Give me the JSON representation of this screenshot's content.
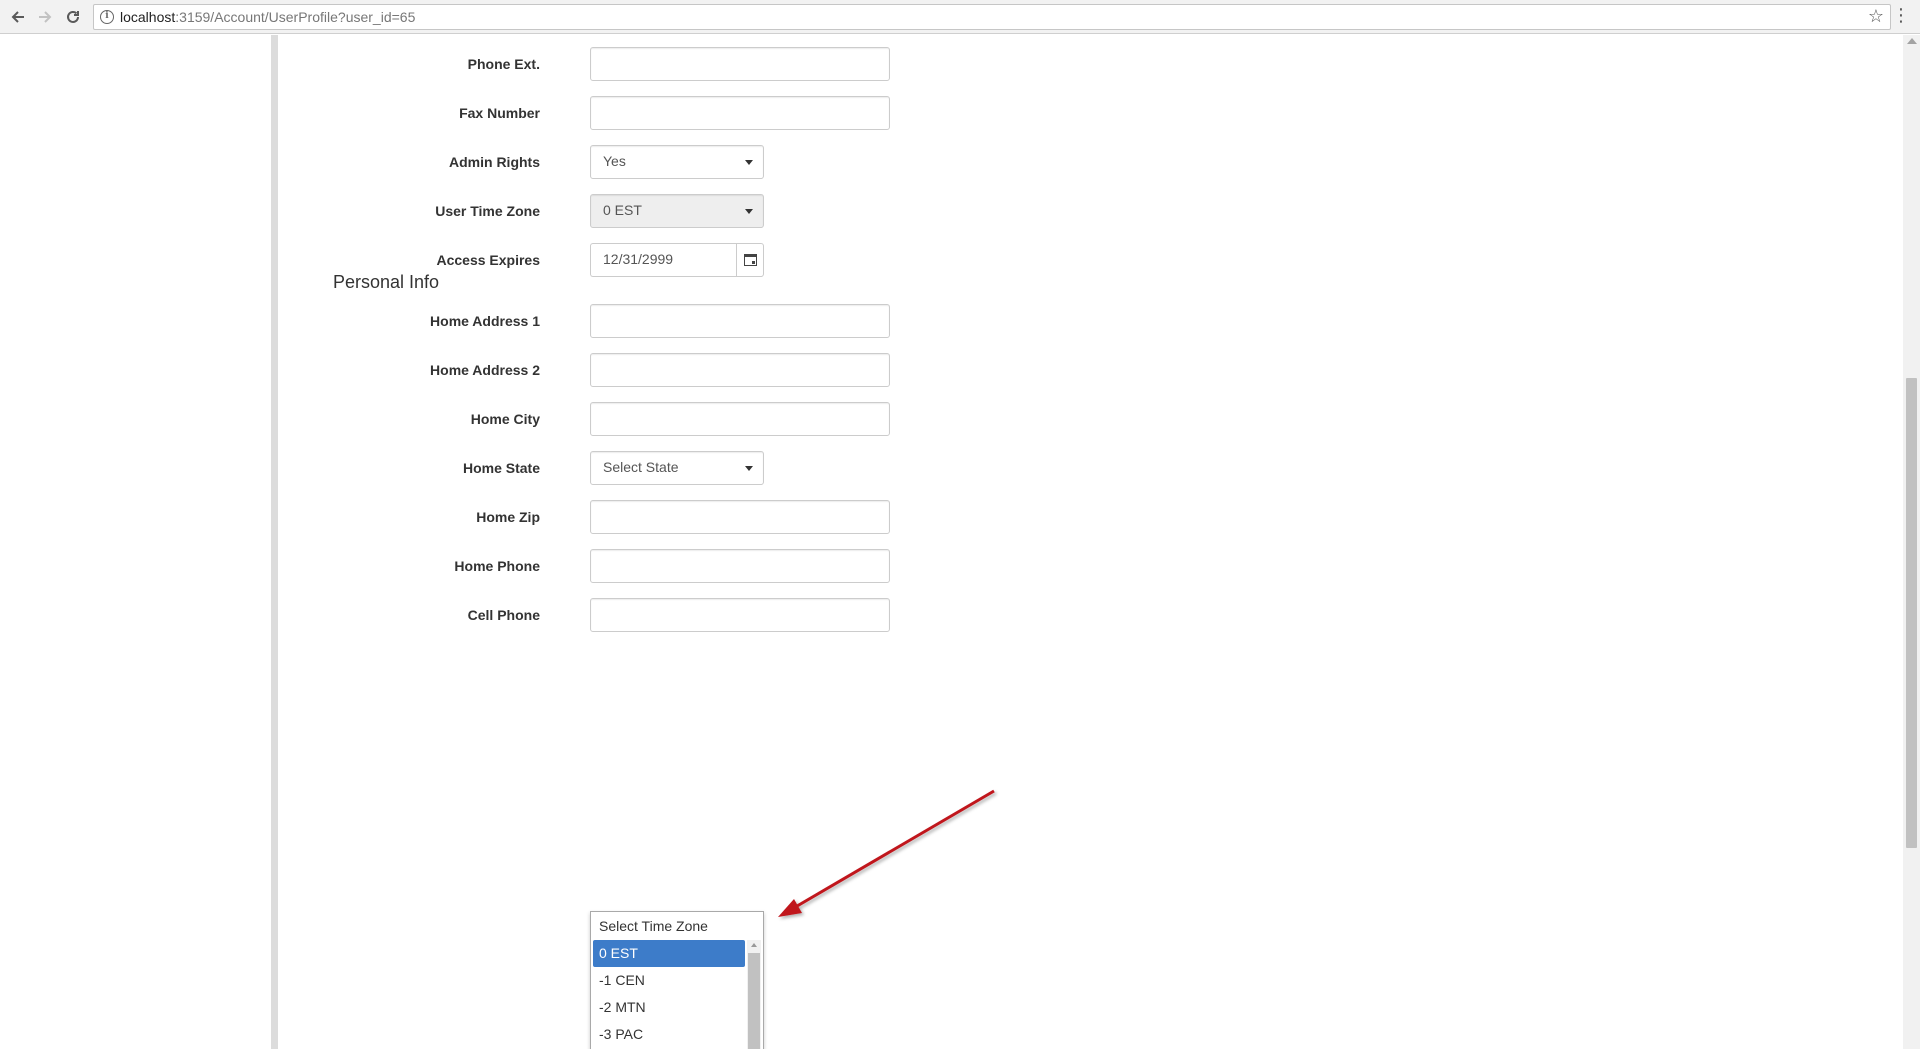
{
  "browser": {
    "url_host": "localhost",
    "url_rest": ":3159/Account/UserProfile?user_id=65",
    "back_icon": "arrow-left-icon",
    "forward_icon": "arrow-right-icon",
    "reload_icon": "reload-icon",
    "star_icon": "star-icon",
    "menu_icon": "kebab-menu-icon"
  },
  "form": {
    "phone_ext": {
      "label": "Phone Ext.",
      "value": ""
    },
    "fax_number": {
      "label": "Fax Number",
      "value": ""
    },
    "admin_rights": {
      "label": "Admin Rights",
      "value": "Yes"
    },
    "user_time_zone": {
      "label": "User Time Zone",
      "value": "0 EST"
    },
    "access_expires": {
      "label": "Access Expires",
      "value": "12/31/2999"
    },
    "personal_info_title": "Personal Info",
    "home_address_1": {
      "label": "Home Address 1",
      "value": ""
    },
    "home_address_2": {
      "label": "Home Address 2",
      "value": ""
    },
    "home_city": {
      "label": "Home City",
      "value": ""
    },
    "home_state": {
      "label": "Home State",
      "value": "Select State"
    },
    "home_zip": {
      "label": "Home Zip",
      "value": ""
    },
    "home_phone": {
      "label": "Home Phone",
      "value": ""
    },
    "cell_phone": {
      "label": "Cell Phone",
      "value": ""
    }
  },
  "timezone_dropdown": {
    "placeholder": "Select Time Zone",
    "options": [
      "0 EST",
      "-1 CEN",
      "-2 MTN",
      "-3 PAC"
    ],
    "selected": "0 EST"
  },
  "colors": {
    "selected_option": "#3d7cc9",
    "annotation_arrow": "#c0141b"
  }
}
